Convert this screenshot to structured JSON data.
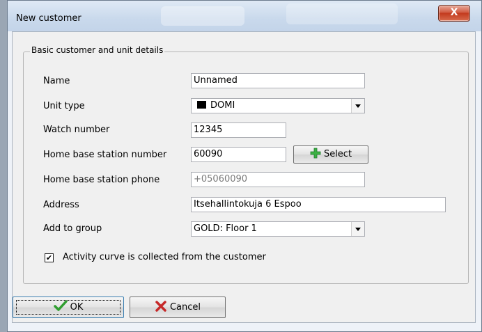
{
  "window": {
    "title": "New customer",
    "close_glyph": "X"
  },
  "groupbox": {
    "label": "Basic customer and unit details"
  },
  "fields": {
    "name": {
      "label": "Name",
      "value": "Unnamed"
    },
    "unit_type": {
      "label": "Unit type",
      "value": "DOMI",
      "swatch_color": "#000000"
    },
    "watch_number": {
      "label": "Watch number",
      "value": "12345"
    },
    "home_base_number": {
      "label": "Home base station number",
      "value": "60090"
    },
    "home_base_phone": {
      "label": "Home base station phone",
      "value": "+05060090"
    },
    "address": {
      "label": "Address",
      "value": "Itsehallintokuja 6 Espoo"
    },
    "group": {
      "label": "Add to group",
      "value": "GOLD: Floor 1"
    }
  },
  "select_button": {
    "label": "Select",
    "icon": "plus-icon",
    "icon_color": "#3cb043"
  },
  "activity_checkbox": {
    "label": "Activity curve is collected from the customer",
    "checked": true,
    "mark": "✔"
  },
  "footer": {
    "ok_label": "OK",
    "ok_icon": "checkmark-icon",
    "ok_icon_color": "#2f9e2f",
    "cancel_label": "Cancel",
    "cancel_icon": "x-icon",
    "cancel_icon_color": "#c62828"
  }
}
